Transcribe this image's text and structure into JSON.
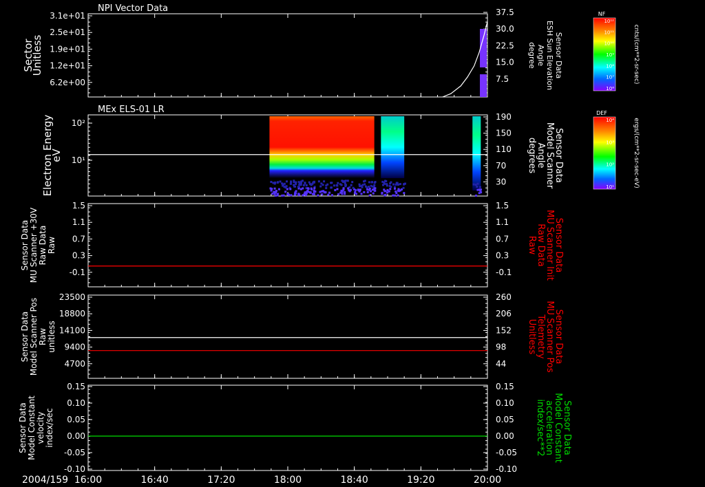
{
  "page": {
    "date_label": "2004/159",
    "colors": {
      "bg": "#000000",
      "axis": "#ffffff",
      "red": "#ff0000",
      "green": "#00dd00",
      "blue": "#3333ff"
    },
    "colorbars": [
      {
        "label": "NF",
        "ticks": [
          "10¹²",
          "10¹¹",
          "10¹⁰",
          "10⁹",
          "10⁸",
          "10⁷",
          "10⁶"
        ],
        "unit": "cnts/(cm**2-sr-sec)"
      },
      {
        "label": "DEF",
        "ticks": [
          "10⁴",
          "10³",
          "10²",
          "10¹"
        ],
        "unit": "ergs/(cm**2-sr-sec-eV)"
      }
    ]
  },
  "chart_data": [
    {
      "type": "heatmap",
      "title": "NPI Vector Data",
      "left_ylabel": [
        "Sector",
        "Unitless"
      ],
      "left_ticks": [
        "3.1e+01",
        "2.5e+01",
        "1.9e+01",
        "1.2e+01",
        "6.2e+00"
      ],
      "right_ylabel": [
        "Sensor Data",
        "ESH Sun Elevation",
        "Angle",
        "degree"
      ],
      "right_ticks": [
        "37.5",
        "30.0",
        "22.5",
        "15.0",
        "7.5"
      ],
      "right_ylim": [
        0,
        37.5
      ],
      "xlim_minutes": [
        0,
        240
      ],
      "white_line": {
        "x": [
          213,
          218,
          224,
          228,
          232,
          235,
          238,
          240
        ],
        "y": [
          0,
          1.5,
          5,
          9,
          14,
          20,
          28,
          34
        ]
      }
    },
    {
      "type": "heatmap",
      "title": "MEx ELS-01 LR",
      "left_ylabel": [
        "Electron Energy",
        "eV"
      ],
      "left_ticks": [
        "10²",
        "10¹"
      ],
      "right_ylabel": [
        "Sensor Data",
        "Model Scanner",
        "Angle",
        "degrees"
      ],
      "right_ticks": [
        "190",
        "150",
        "110",
        "70",
        "30"
      ],
      "right_ylim": [
        0,
        190
      ],
      "white_line_value": 97,
      "data_intervals_minutes": [
        [
          109,
          172
        ],
        [
          176,
          190
        ],
        [
          231,
          236
        ]
      ]
    },
    {
      "type": "line",
      "left_ylabel": [
        "Sensor Data",
        "MU Scanner +30V",
        "Raw Data",
        "Raw"
      ],
      "left_ticks": [
        "1.5",
        "1.1",
        "0.7",
        "0.3",
        "-0.1"
      ],
      "right_ylabel": [
        "Sensor Data",
        "MU Scanner Init",
        "Raw Data",
        "Raw"
      ],
      "right_ticks": [
        "1.5",
        "1.1",
        "0.7",
        "0.3",
        "-0.1"
      ],
      "ylim": [
        -0.5,
        1.5
      ],
      "series": [
        {
          "color": "#ff0000",
          "values": [
            0.0
          ]
        }
      ]
    },
    {
      "type": "line",
      "left_ylabel": [
        "Sensor Data",
        "Model Scanner Pos",
        "Raw",
        "unitless"
      ],
      "left_ticks": [
        "23500",
        "18800",
        "14100",
        "9400",
        "4700"
      ],
      "right_ylabel": [
        "Sensor Data",
        "MU Scanner Pos",
        "Telemetry",
        "Unitless"
      ],
      "right_ticks": [
        "260",
        "206",
        "152",
        "98",
        "44"
      ],
      "ylim_left": [
        0,
        23500
      ],
      "ylim_right": [
        -10,
        260
      ],
      "series": [
        {
          "color": "#ffffff",
          "axis": "left",
          "values": [
            11500
          ]
        },
        {
          "color": "#ff0000",
          "axis": "right",
          "values": [
            80
          ]
        }
      ]
    },
    {
      "type": "line",
      "left_ylabel": [
        "Sensor Data",
        "Model Constant",
        "velocity",
        "index/sec"
      ],
      "left_ticks": [
        "0.15",
        "0.10",
        "0.05",
        "0.00",
        "-0.05",
        "-0.10"
      ],
      "right_ylabel": [
        "Sensor Data",
        "Model Constant",
        "acceleration",
        "index/sec**2"
      ],
      "right_ticks": [
        "0.15",
        "0.10",
        "0.05",
        "0.00",
        "-0.05",
        "-0.10"
      ],
      "ylim": [
        -0.1,
        0.15
      ],
      "series": [
        {
          "color": "#00dd00",
          "values": [
            0.0
          ]
        }
      ]
    }
  ],
  "x_axis": {
    "ticks": [
      "16:00",
      "16:40",
      "17:20",
      "18:00",
      "18:40",
      "19:20",
      "20:00"
    ],
    "xlim_minutes": [
      0,
      240
    ]
  }
}
